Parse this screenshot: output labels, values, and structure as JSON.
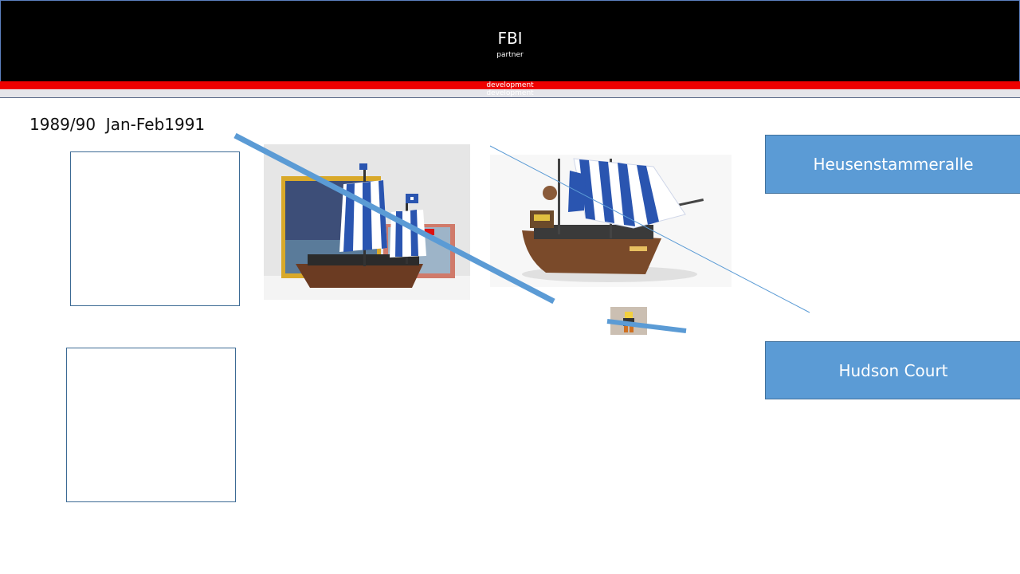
{
  "header": {
    "title": "FBI",
    "subtitle": "partner"
  },
  "bands": {
    "red_label": "development",
    "gray_label": "development"
  },
  "date_text": "1989/90  Jan-Feb1991",
  "boxes": {
    "top": "Heusenstammeralle",
    "bottom": "Hudson Court"
  },
  "colors": {
    "header_bg": "#000000",
    "band_red": "#ee0000",
    "band_gray": "#e5e5ea",
    "box_fill": "#5b9bd5",
    "line_color": "#5b9bd5"
  }
}
